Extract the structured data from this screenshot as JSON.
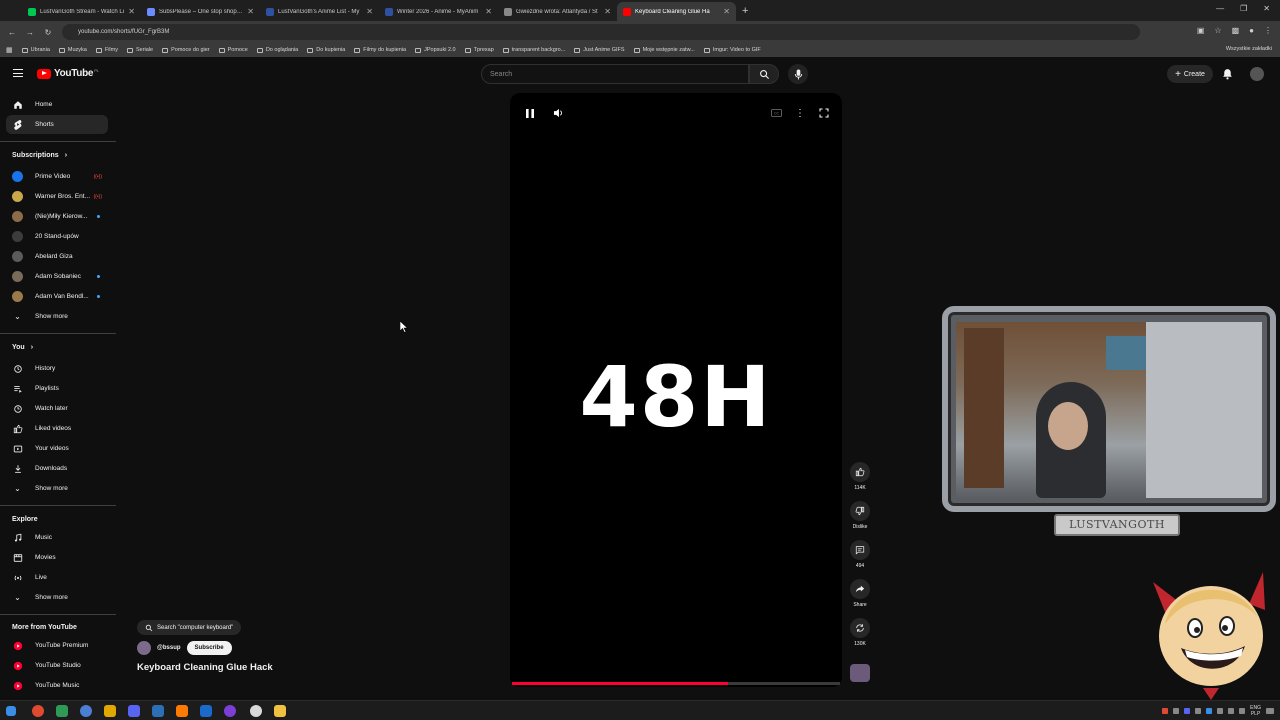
{
  "browser": {
    "tabs": [
      {
        "title": "LustVanGoth Stream - Watch Li",
        "color": "#00c853"
      },
      {
        "title": "SubsPlease – One stop shop fo",
        "color": "#6a8cff"
      },
      {
        "title": "LustVanGoth's Anime List - My",
        "color": "#2e51a2"
      },
      {
        "title": "Winter 2026 - Anime - MyAnim",
        "color": "#2e51a2"
      },
      {
        "title": "Gwiezdne wrota: Atlantyda / St",
        "color": "#888888"
      },
      {
        "title": "Keyboard Cleaning Glue Ha",
        "color": "#ff0000"
      }
    ],
    "url": "youtube.com/shorts/fUGr_FgrB3M",
    "bookmarks": [
      "Ubrania",
      "Muzyka",
      "Filmy",
      "Seriale",
      "Pomoce do gier",
      "Pomoce",
      "Do oglądania",
      "Do kupienia",
      "Filmy do kupienia",
      "JPopsuki 2.0",
      "Tprexap",
      "transparent backgro...",
      "Just Anime GIFS",
      "Moje wstępnie zatw...",
      "Imgur: Video to GIF"
    ],
    "bookmarks_right": "Wszystkie zakładki"
  },
  "header": {
    "logo": "YouTube",
    "logo_region": "PL",
    "search_placeholder": "Search",
    "create_label": "Create"
  },
  "sidebar": {
    "main": [
      {
        "label": "Home",
        "icon": "home-icon"
      },
      {
        "label": "Shorts",
        "icon": "shorts-icon"
      }
    ],
    "subscriptions_heading": "Subscriptions",
    "subscriptions": [
      {
        "label": "Prime Video",
        "color": "#1a73e8",
        "marker": "live"
      },
      {
        "label": "Warner Bros. Ent...",
        "color": "#c9a84a",
        "marker": "live"
      },
      {
        "label": "(Nie)Miły Kierow...",
        "color": "#8b6b4a",
        "marker": "dot"
      },
      {
        "label": "20 Stand-upów",
        "color": "#3c3c3c",
        "marker": "none"
      },
      {
        "label": "Abelard Giza",
        "color": "#5b5b5b",
        "marker": "none"
      },
      {
        "label": "Adam Sobaniec",
        "color": "#7a6a5a",
        "marker": "dot"
      },
      {
        "label": "Adam Van Bendl...",
        "color": "#9a7a4a",
        "marker": "dot"
      }
    ],
    "show_more_1": "Show more",
    "you_heading": "You",
    "you": [
      {
        "label": "History",
        "icon": "history-icon"
      },
      {
        "label": "Playlists",
        "icon": "playlists-icon"
      },
      {
        "label": "Watch later",
        "icon": "watch-later-icon"
      },
      {
        "label": "Liked videos",
        "icon": "liked-videos-icon"
      },
      {
        "label": "Your videos",
        "icon": "your-videos-icon"
      },
      {
        "label": "Downloads",
        "icon": "downloads-icon"
      }
    ],
    "show_more_2": "Show more",
    "explore_heading": "Explore",
    "explore": [
      {
        "label": "Music",
        "icon": "music-icon"
      },
      {
        "label": "Movies",
        "icon": "movies-icon"
      },
      {
        "label": "Live",
        "icon": "live-icon"
      }
    ],
    "show_more_3": "Show more",
    "more_heading": "More from YouTube",
    "more": [
      {
        "label": "YouTube Premium"
      },
      {
        "label": "YouTube Studio"
      },
      {
        "label": "YouTube Music"
      }
    ]
  },
  "player": {
    "overlay_text": "48H",
    "progress": 0.66
  },
  "actions": {
    "likes": "114K",
    "dislike": "Dislike",
    "comments": "494",
    "share": "Share",
    "remix": "130K"
  },
  "short_meta": {
    "search_chip": "Search \"computer keyboard\"",
    "channel": "@bssup",
    "subscribe": "Subscribe",
    "title": "Keyboard Cleaning Glue Hack"
  },
  "stream_overlay": {
    "nameplate": "LUSTVANGOTH"
  },
  "taskbar": {
    "lang_top": "ENG",
    "lang_bottom": "PLP"
  }
}
